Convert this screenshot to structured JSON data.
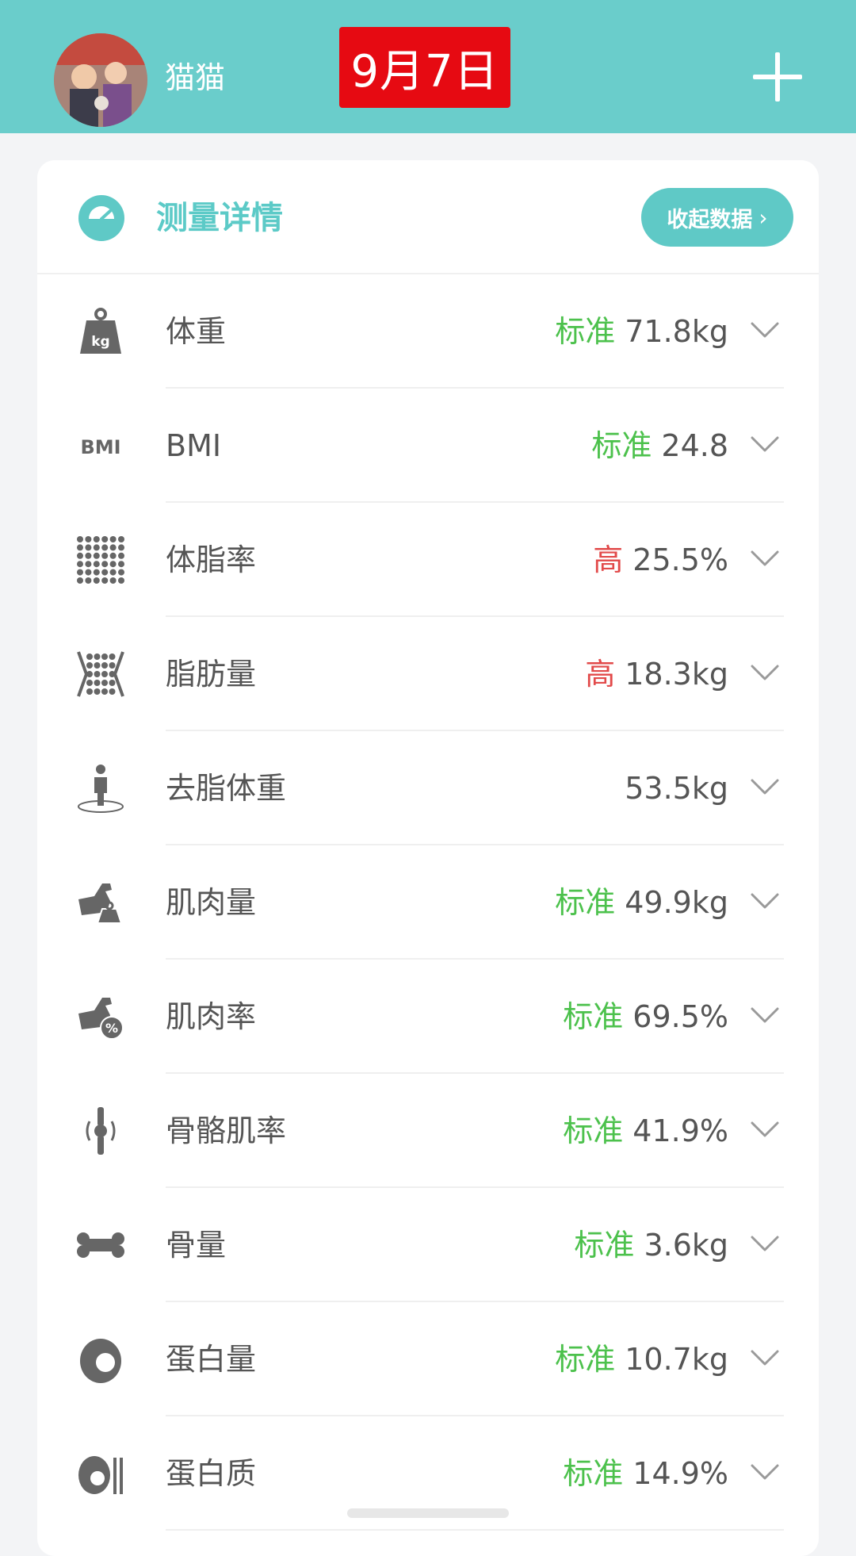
{
  "header": {
    "username": "猫猫",
    "date": "9月7日",
    "add_icon": "plus-icon"
  },
  "card": {
    "title": "测量详情",
    "collapse_label": "收起数据",
    "collapse_chevron": "›"
  },
  "colors": {
    "accent": "#5fc9c6",
    "status_normal": "#4cc14c",
    "status_high": "#e24a4a",
    "date_badge": "#e60a12"
  },
  "metrics": [
    {
      "icon": "weight-kg-icon",
      "label": "体重",
      "status": "标准",
      "status_type": "normal",
      "value": "71.8kg"
    },
    {
      "icon": "bmi-icon",
      "icon_text": "BMI",
      "label": "BMI",
      "status": "标准",
      "status_type": "normal",
      "value": "24.8"
    },
    {
      "icon": "body-fat-rate-icon",
      "label": "体脂率",
      "status": "高",
      "status_type": "high",
      "value": "25.5%"
    },
    {
      "icon": "fat-mass-icon",
      "label": "脂肪量",
      "status": "高",
      "status_type": "high",
      "value": "18.3kg"
    },
    {
      "icon": "lean-body-mass-icon",
      "label": "去脂体重",
      "status": "",
      "status_type": "none",
      "value": "53.5kg"
    },
    {
      "icon": "muscle-mass-icon",
      "label": "肌肉量",
      "status": "标准",
      "status_type": "normal",
      "value": "49.9kg"
    },
    {
      "icon": "muscle-rate-icon",
      "label": "肌肉率",
      "status": "标准",
      "status_type": "normal",
      "value": "69.5%"
    },
    {
      "icon": "skeletal-muscle-icon",
      "label": "骨骼肌率",
      "status": "标准",
      "status_type": "normal",
      "value": "41.9%"
    },
    {
      "icon": "bone-icon",
      "label": "骨量",
      "status": "标准",
      "status_type": "normal",
      "value": "3.6kg"
    },
    {
      "icon": "protein-mass-icon",
      "label": "蛋白量",
      "status": "标准",
      "status_type": "normal",
      "value": "10.7kg"
    },
    {
      "icon": "protein-icon",
      "label": "蛋白质",
      "status": "标准",
      "status_type": "normal",
      "value": "14.9%"
    }
  ]
}
